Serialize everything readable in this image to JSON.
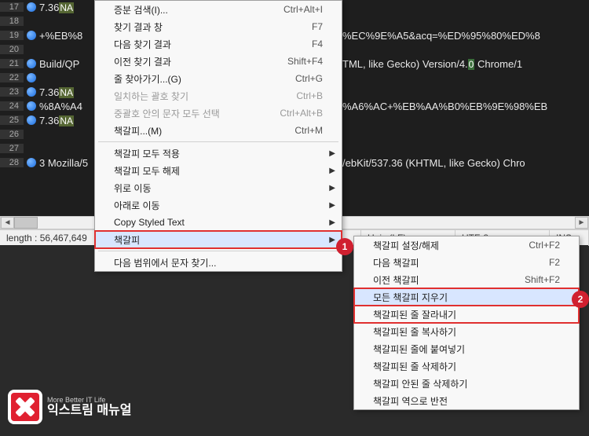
{
  "editor": {
    "lines": [
      {
        "num": "17",
        "bookmark": true,
        "left": "7.36",
        "left_hl": "NA",
        "right": ""
      },
      {
        "num": "18",
        "bookmark": false,
        "left": "",
        "left_hl": "",
        "right": ""
      },
      {
        "num": "19",
        "bookmark": true,
        "left": "+%EB%8",
        "left_hl": "",
        "right": "%EC%9E%A5&acq=%ED%95%80%ED%8"
      },
      {
        "num": "20",
        "bookmark": false,
        "left": "",
        "left_hl": "",
        "right": ""
      },
      {
        "num": "21",
        "bookmark": true,
        "left": "Build/QP",
        "left_hl": "",
        "right": "TML, like Gecko) Version/4.0 Chrome/1",
        "right_hl_char": "0"
      },
      {
        "num": "22",
        "bookmark": true,
        "left": "",
        "left_hl": "",
        "right": ""
      },
      {
        "num": "23",
        "bookmark": true,
        "left": "7.36",
        "left_hl": "NA",
        "right": ""
      },
      {
        "num": "24",
        "bookmark": true,
        "left": "%8A%A4",
        "left_hl": "",
        "right": "%A6%AC+%EB%AA%B0%EB%9E%98%EB"
      },
      {
        "num": "25",
        "bookmark": true,
        "left": "7.36",
        "left_hl": "NA",
        "right": ""
      },
      {
        "num": "26",
        "bookmark": false,
        "left": "",
        "left_hl": "",
        "right": ""
      },
      {
        "num": "27",
        "bookmark": false,
        "left": "",
        "left_hl": "",
        "right": ""
      },
      {
        "num": "28",
        "bookmark": true,
        "left": "3 Mozilla/5",
        "left_hl": "",
        "right": "/ebKit/537.36 (KHTML, like Gecko) Chro"
      }
    ]
  },
  "status": {
    "length": "length : 56,467,649",
    "eol": "Unix (LF)",
    "encoding": "UTF-8",
    "mode": "INS"
  },
  "menu1": {
    "items": [
      {
        "label": "증분 검색(I)...",
        "shortcut": "Ctrl+Alt+I",
        "type": "item"
      },
      {
        "label": "찾기 결과 창",
        "shortcut": "F7",
        "type": "item"
      },
      {
        "label": "다음 찾기 결과",
        "shortcut": "F4",
        "type": "item"
      },
      {
        "label": "이전 찾기 결과",
        "shortcut": "Shift+F4",
        "type": "item"
      },
      {
        "label": "줄 찾아가기...(G)",
        "shortcut": "Ctrl+G",
        "type": "item"
      },
      {
        "label": "일치하는 괄호 찾기",
        "shortcut": "Ctrl+B",
        "type": "item",
        "disabled": true
      },
      {
        "label": "중괄호 안의 문자 모두 선택",
        "shortcut": "Ctrl+Alt+B",
        "type": "item",
        "disabled": true
      },
      {
        "label": "책갈피...(M)",
        "shortcut": "Ctrl+M",
        "type": "item"
      },
      {
        "type": "sep"
      },
      {
        "label": "책갈피 모두 적용",
        "arrow": true,
        "type": "item"
      },
      {
        "label": "책갈피 모두 해제",
        "arrow": true,
        "type": "item"
      },
      {
        "label": "위로 이동",
        "arrow": true,
        "type": "item"
      },
      {
        "label": "아래로 이동",
        "arrow": true,
        "type": "item"
      },
      {
        "label": "Copy Styled Text",
        "arrow": true,
        "type": "item"
      },
      {
        "label": "책갈피",
        "arrow": true,
        "type": "item",
        "hover": true,
        "hl": true
      },
      {
        "type": "sep"
      },
      {
        "label": "다음 범위에서 문자 찾기...",
        "type": "item"
      }
    ]
  },
  "menu2": {
    "items": [
      {
        "label": "책갈피 설정/해제",
        "shortcut": "Ctrl+F2",
        "type": "item"
      },
      {
        "label": "다음 책갈피",
        "shortcut": "F2",
        "type": "item"
      },
      {
        "label": "이전 책갈피",
        "shortcut": "Shift+F2",
        "type": "item"
      },
      {
        "label": "모든 책갈피 지우기",
        "type": "item",
        "hover": true,
        "hl": true
      },
      {
        "label": "책갈피된 줄 잘라내기",
        "type": "item",
        "hl": true
      },
      {
        "label": "책갈피된 줄 복사하기",
        "type": "item"
      },
      {
        "label": "책갈피된 줄에 붙여넣기",
        "type": "item"
      },
      {
        "label": "책갈피된 줄 삭제하기",
        "type": "item"
      },
      {
        "label": "책갈피 안된 줄 삭제하기",
        "type": "item"
      },
      {
        "label": "책갈피 역으로 반전",
        "type": "item"
      }
    ]
  },
  "badges": {
    "b1": "1",
    "b2": "2"
  },
  "logo": {
    "title": "익스트림 매뉴얼",
    "sub": "More Better IT Life"
  }
}
